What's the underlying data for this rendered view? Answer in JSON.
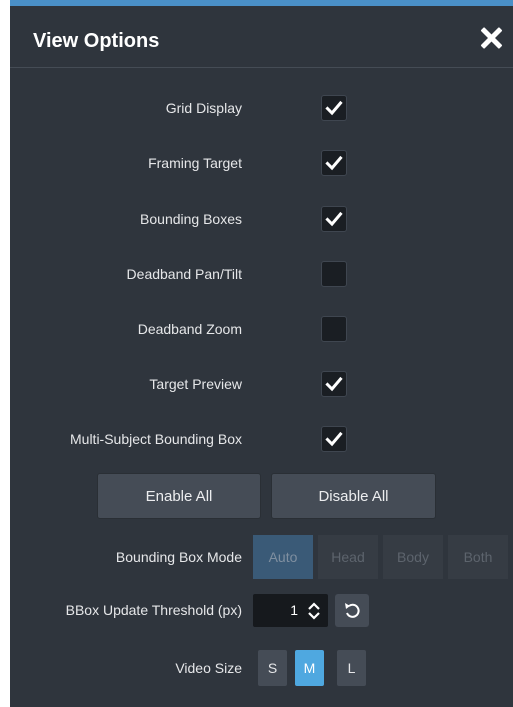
{
  "dialog": {
    "title": "View Options"
  },
  "options": [
    {
      "label": "Grid Display",
      "checked": true
    },
    {
      "label": "Framing Target",
      "checked": true
    },
    {
      "label": "Bounding Boxes",
      "checked": true
    },
    {
      "label": "Deadband Pan/Tilt",
      "checked": false
    },
    {
      "label": "Deadband Zoom",
      "checked": false
    },
    {
      "label": "Target Preview",
      "checked": true
    },
    {
      "label": "Multi-Subject Bounding Box",
      "checked": true
    }
  ],
  "buttons": {
    "enable_all": "Enable All",
    "disable_all": "Disable All"
  },
  "bbox_mode": {
    "label": "Bounding Box Mode",
    "options": [
      "Auto",
      "Head",
      "Body",
      "Both"
    ],
    "selected": "Auto"
  },
  "threshold": {
    "label": "BBox Update Threshold (px)",
    "value": "1"
  },
  "video_size": {
    "label": "Video Size",
    "options": [
      "S",
      "M",
      "L"
    ],
    "selected": "M"
  },
  "colors": {
    "panel": "#2f353d",
    "accent": "#4a90c8",
    "selected_mode": "#3a5a77",
    "selected_size": "#4fa8e0"
  }
}
